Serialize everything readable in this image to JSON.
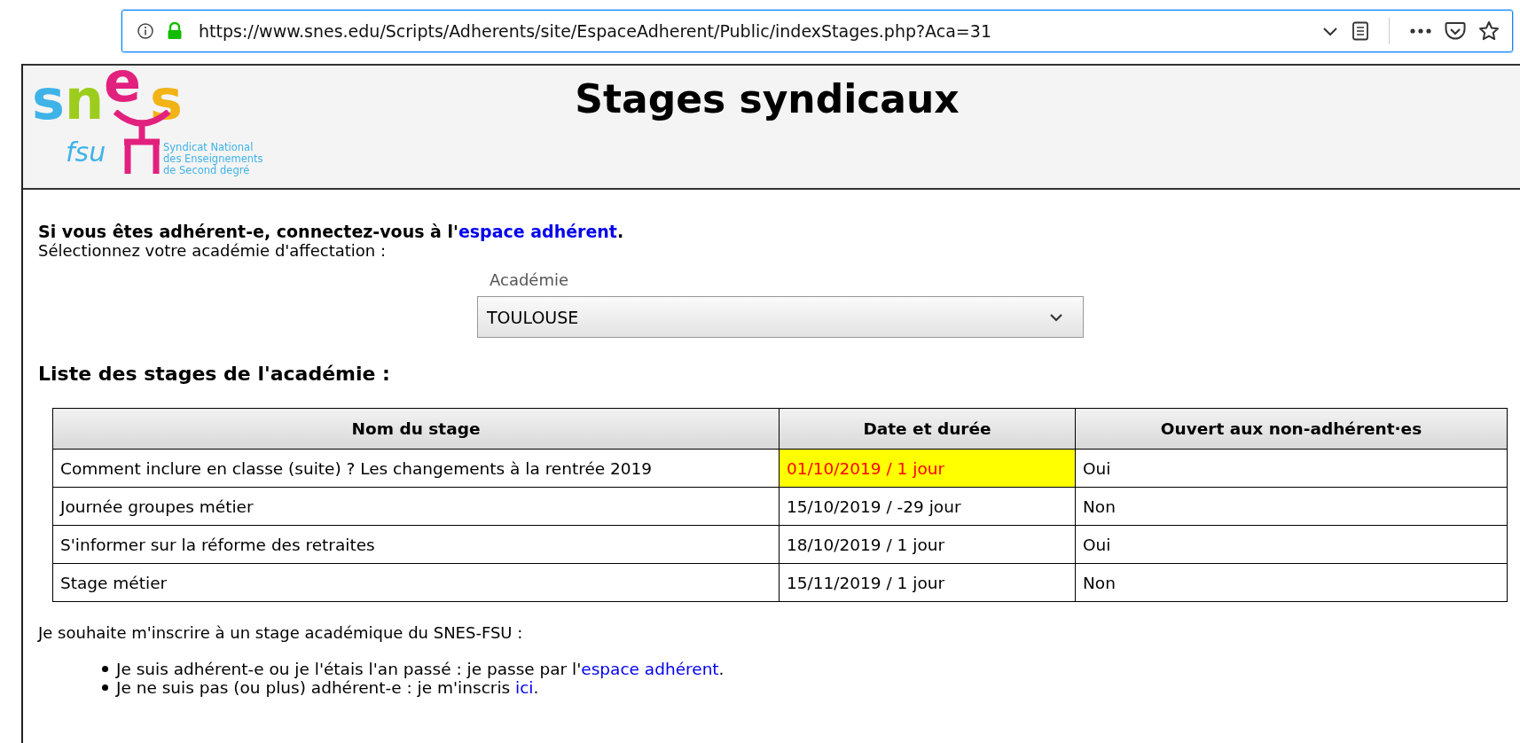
{
  "browser": {
    "url": "https://www.snes.edu/Scripts/Adherents/site/EspaceAdherent/Public/indexStages.php?Aca=31"
  },
  "header": {
    "logo": {
      "letters": [
        {
          "text": "s",
          "color": "#3fb3e8"
        },
        {
          "text": "n",
          "color": "#9ccd1d"
        },
        {
          "text": "e",
          "color": "#e2217e"
        },
        {
          "text": "s",
          "color": "#f2b315"
        }
      ],
      "sub": "fsu",
      "caption": [
        "Syndicat National",
        "des Enseignements",
        "de Second degré"
      ]
    },
    "title": "Stages syndicaux"
  },
  "intro": {
    "before": "Si vous êtes adhérent-e, connectez-vous à l'",
    "link": "espace adhérent",
    "after": "."
  },
  "prompt": "Sélectionnez votre académie d'affectation :",
  "select": {
    "label": "Académie",
    "value": "TOULOUSE"
  },
  "list_heading": "Liste des stages de l'académie :",
  "table": {
    "columns": [
      "Nom du stage",
      "Date et durée",
      "Ouvert aux non-adhérent·es"
    ],
    "rows": [
      {
        "name": "Comment inclure en classe (suite) ? Les changements à la rentrée 2019",
        "date": "01/10/2019 / 1 jour",
        "open": "Oui",
        "highlighted": true
      },
      {
        "name": "Journée groupes métier",
        "date": "15/10/2019 / -29 jour",
        "open": "Non",
        "highlighted": false
      },
      {
        "name": "S'informer sur la réforme des retraites",
        "date": "18/10/2019 / 1 jour",
        "open": "Oui",
        "highlighted": false
      },
      {
        "name": "Stage métier",
        "date": "15/11/2019 / 1 jour",
        "open": "Non",
        "highlighted": false
      }
    ]
  },
  "register": {
    "text": "Je souhaite m'inscrire à un stage académique du SNES-FSU :",
    "items": [
      {
        "before": "Je suis adhérent-e ou je l'étais l'an passé : je passe par l'",
        "link": "espace adhérent",
        "after": "."
      },
      {
        "before": "Je ne suis pas (ou plus) adhérent-e : je m'inscris ",
        "link": "ici",
        "after": "."
      }
    ]
  }
}
